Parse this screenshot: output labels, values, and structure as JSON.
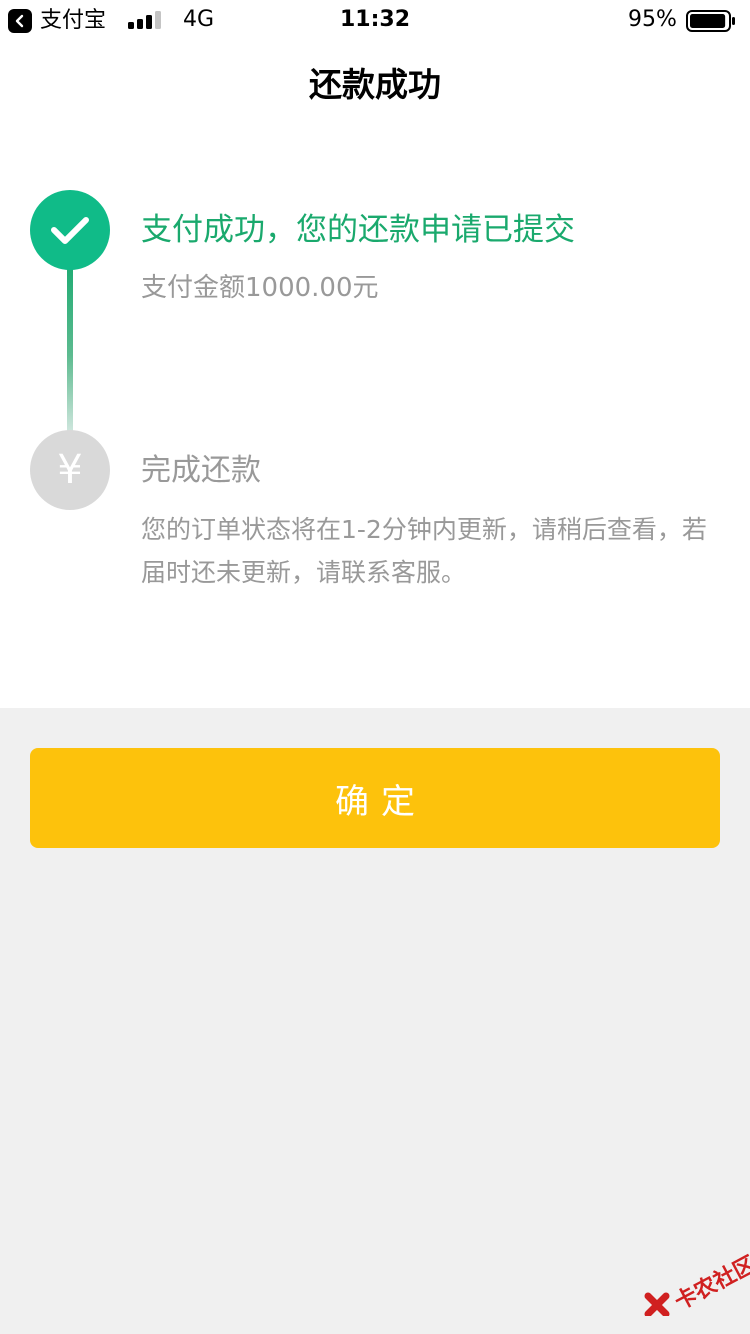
{
  "status_bar": {
    "back_app_label": "支付宝",
    "network": "4G",
    "time": "11:32",
    "battery_percent": "95%",
    "battery_level": 0.95,
    "signal_bars_active": 3,
    "signal_bars_total": 4
  },
  "nav": {
    "title": "还款成功"
  },
  "steps": [
    {
      "title": "支付成功，您的还款申请已提交",
      "description": "支付金额1000.00元",
      "icon": "check-icon",
      "status": "done",
      "color": "#10bb88"
    },
    {
      "title": "完成还款",
      "description": "您的订单状态将在1-2分钟内更新，请稍后查看，若届时还未更新，请联系客服。",
      "icon": "yen-icon",
      "status": "pending",
      "color": "#d9d9d9"
    }
  ],
  "confirm_button": {
    "label": "确定",
    "color": "#fdc20c"
  },
  "watermark": {
    "text": "卡农社区",
    "icon": "logo-x-icon"
  },
  "colors": {
    "accent_green": "#1aa96d",
    "page_background": "#f0f0f0",
    "muted_text": "#999999"
  }
}
